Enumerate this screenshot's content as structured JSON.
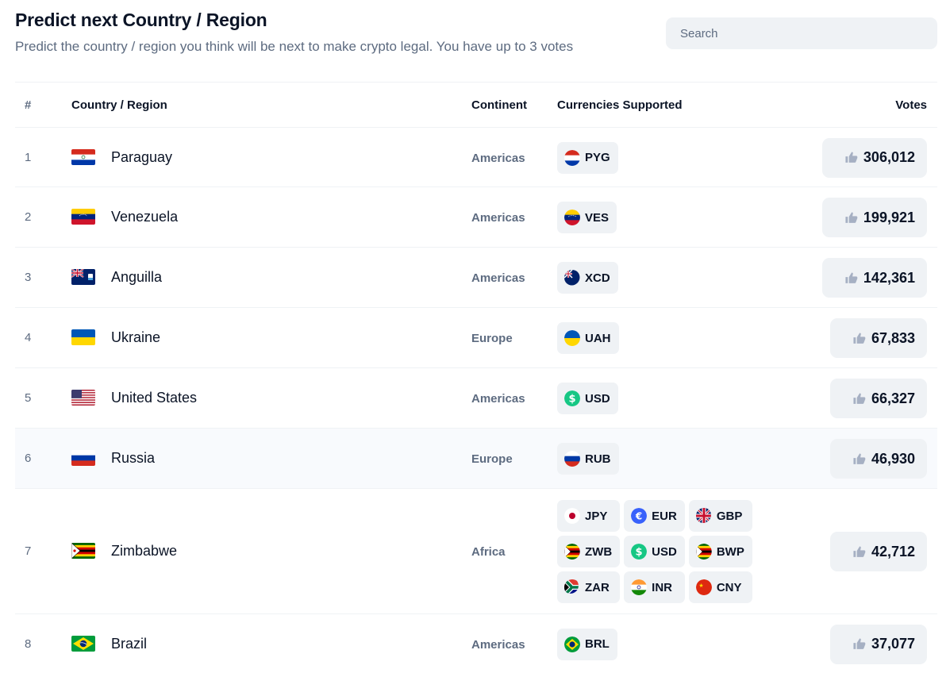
{
  "header": {
    "title": "Predict next Country / Region",
    "subtitle": "Predict the country / region you think will be next to make crypto legal. You have up to 3 votes",
    "search_placeholder": "Search"
  },
  "table": {
    "columns": {
      "num": "#",
      "country": "Country / Region",
      "continent": "Continent",
      "currencies": "Currencies Supported",
      "votes": "Votes"
    },
    "rows": [
      {
        "num": "1",
        "country": "Paraguay",
        "continent": "Americas",
        "currencies": [
          "PYG"
        ],
        "votes": "306,012"
      },
      {
        "num": "2",
        "country": "Venezuela",
        "continent": "Americas",
        "currencies": [
          "VES"
        ],
        "votes": "199,921"
      },
      {
        "num": "3",
        "country": "Anguilla",
        "continent": "Americas",
        "currencies": [
          "XCD"
        ],
        "votes": "142,361"
      },
      {
        "num": "4",
        "country": "Ukraine",
        "continent": "Europe",
        "currencies": [
          "UAH"
        ],
        "votes": "67,833"
      },
      {
        "num": "5",
        "country": "United States",
        "continent": "Americas",
        "currencies": [
          "USD"
        ],
        "votes": "66,327"
      },
      {
        "num": "6",
        "country": "Russia",
        "continent": "Europe",
        "currencies": [
          "RUB"
        ],
        "votes": "46,930"
      },
      {
        "num": "7",
        "country": "Zimbabwe",
        "continent": "Africa",
        "currencies": [
          "JPY",
          "EUR",
          "GBP",
          "ZWB",
          "USD",
          "BWP",
          "ZAR",
          "INR",
          "CNY"
        ],
        "votes": "42,712"
      },
      {
        "num": "8",
        "country": "Brazil",
        "continent": "Americas",
        "currencies": [
          "BRL"
        ],
        "votes": "37,077"
      }
    ]
  },
  "colors": {
    "text": "#0b1426",
    "muted": "#5d6b80",
    "chip_bg": "#eff2f5",
    "row_highlight": "#f8fafd",
    "thumb_icon": "#a6b0c3"
  },
  "icons": {
    "vote": "thumbs-up-icon",
    "usd": "dollar-sign-icon",
    "eur": "euro-sign-icon"
  }
}
